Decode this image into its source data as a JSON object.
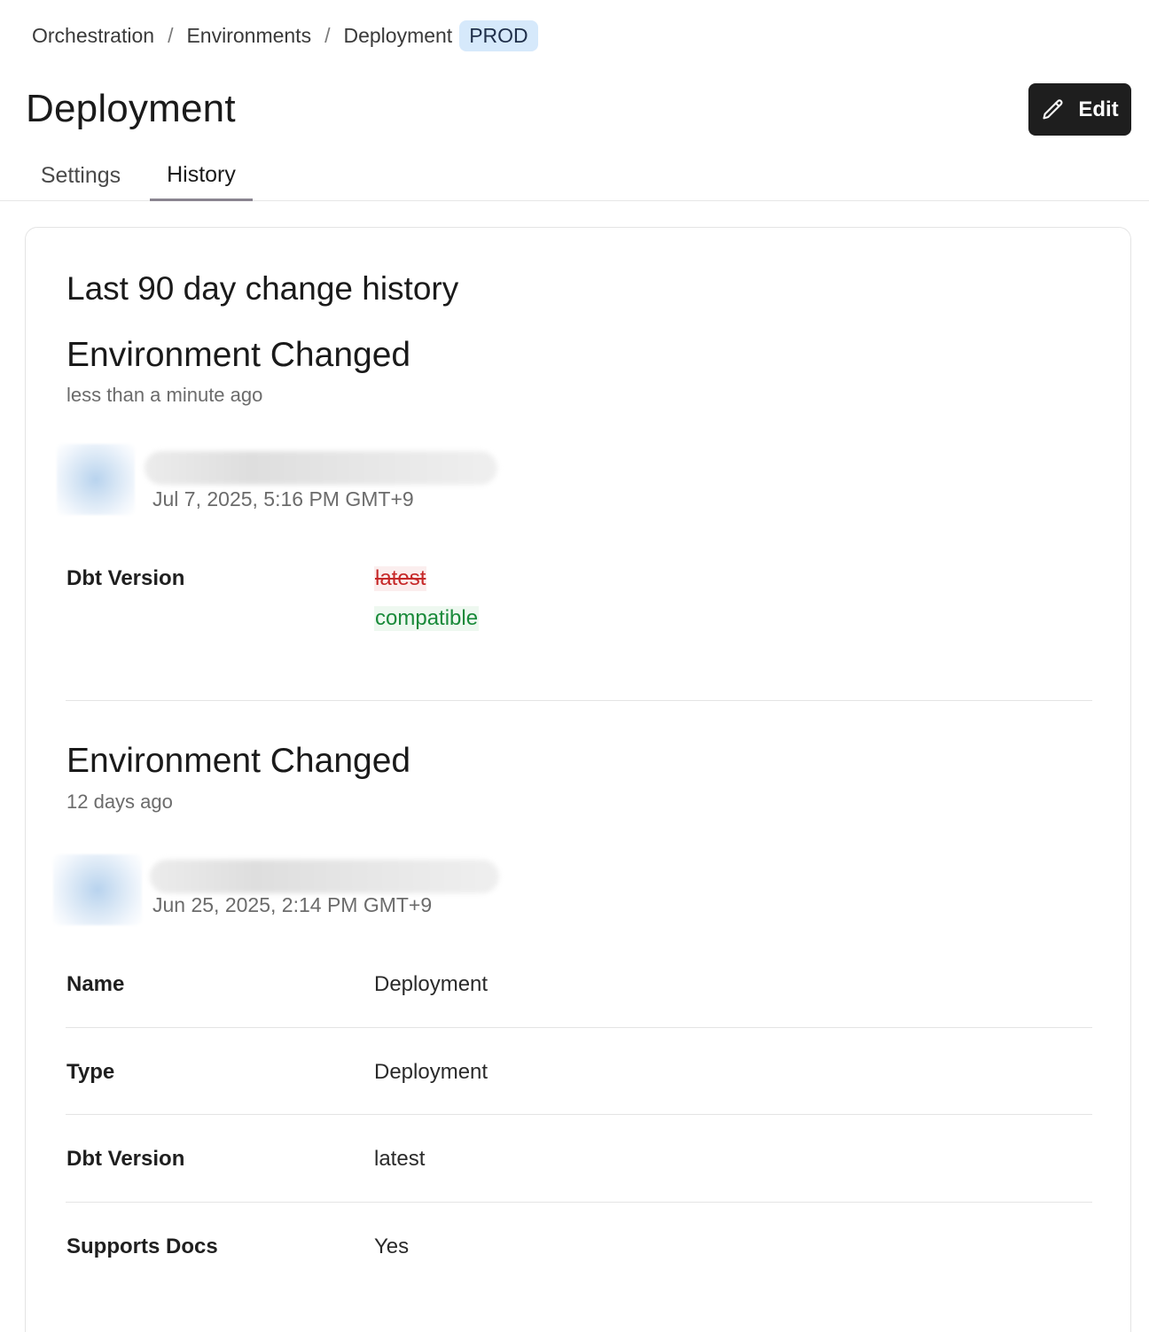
{
  "breadcrumb": {
    "items": [
      "Orchestration",
      "Environments",
      "Deployment"
    ],
    "separator": "/",
    "badge": "PROD"
  },
  "header": {
    "title": "Deployment",
    "edit_label": "Edit"
  },
  "tabs": [
    {
      "label": "Settings",
      "active": false
    },
    {
      "label": "History",
      "active": true
    }
  ],
  "history": {
    "title": "Last 90 day change history",
    "events": [
      {
        "title": "Environment Changed",
        "ago": "less than a minute ago",
        "timestamp": "Jul 7, 2025, 5:16 PM GMT+9",
        "changes": [
          {
            "field": "Dbt Version",
            "old": "latest",
            "new": "compatible"
          }
        ]
      },
      {
        "title": "Environment Changed",
        "ago": "12 days ago",
        "timestamp": "Jun 25, 2025, 2:14 PM GMT+9",
        "fields": [
          {
            "label": "Name",
            "value": "Deployment"
          },
          {
            "label": "Type",
            "value": "Deployment"
          },
          {
            "label": "Dbt Version",
            "value": "latest"
          },
          {
            "label": "Supports Docs",
            "value": "Yes"
          }
        ]
      }
    ]
  },
  "colors": {
    "badge_bg": "#d6e9fb",
    "edit_bg": "#1e1e1e",
    "removed": "#c62828",
    "added": "#198a3a"
  }
}
